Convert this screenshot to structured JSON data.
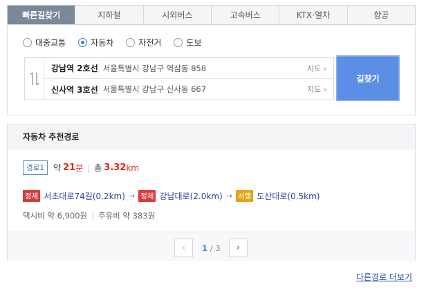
{
  "tabs": [
    {
      "label": "빠른길찾기",
      "active": true
    },
    {
      "label": "지하철",
      "active": false
    },
    {
      "label": "시외버스",
      "active": false
    },
    {
      "label": "고속버스",
      "active": false
    },
    {
      "label": "KTX·열차",
      "active": false
    },
    {
      "label": "항공",
      "active": false
    }
  ],
  "modes": [
    {
      "label": "대중교통",
      "selected": false
    },
    {
      "label": "자동차",
      "selected": true
    },
    {
      "label": "자전거",
      "selected": false
    },
    {
      "label": "도보",
      "selected": false
    }
  ],
  "route": {
    "swap_icon": "swap-vertical-icon",
    "from": {
      "name": "강남역 2호선",
      "address": "서울특별시 강남구 역삼동 858",
      "map_label": "지도"
    },
    "to": {
      "name": "신사역 3호선",
      "address": "서울특별시 강남구 신사동 667",
      "map_label": "지도"
    }
  },
  "find_button": "길찾기",
  "results": {
    "header": "자동차 추천경로",
    "route_tag": "경로1",
    "time_prefix": "약",
    "time_value": "21",
    "time_unit": "분",
    "distance_prefix": "총",
    "distance_value": "3.32",
    "distance_unit": "km",
    "segments": [
      {
        "status": "정체",
        "status_type": "jam",
        "road": "서초대로74길(0.2km)"
      },
      {
        "status": "정체",
        "status_type": "jam",
        "road": "강남대로(2.0km)"
      },
      {
        "status": "서행",
        "status_type": "slow",
        "road": "도산대로(0.5km)"
      }
    ],
    "taxi_fare": "택시비 약 6,900원",
    "fuel_cost": "주유비 약 383원",
    "pager": {
      "current": "1",
      "separator": "/",
      "total": "3"
    }
  },
  "more_link": "다른경로 더보기",
  "colors": {
    "accent": "#5b8fe6",
    "jam": "#d63c3c",
    "slow": "#e3a518",
    "highlight": "#e1251b"
  }
}
